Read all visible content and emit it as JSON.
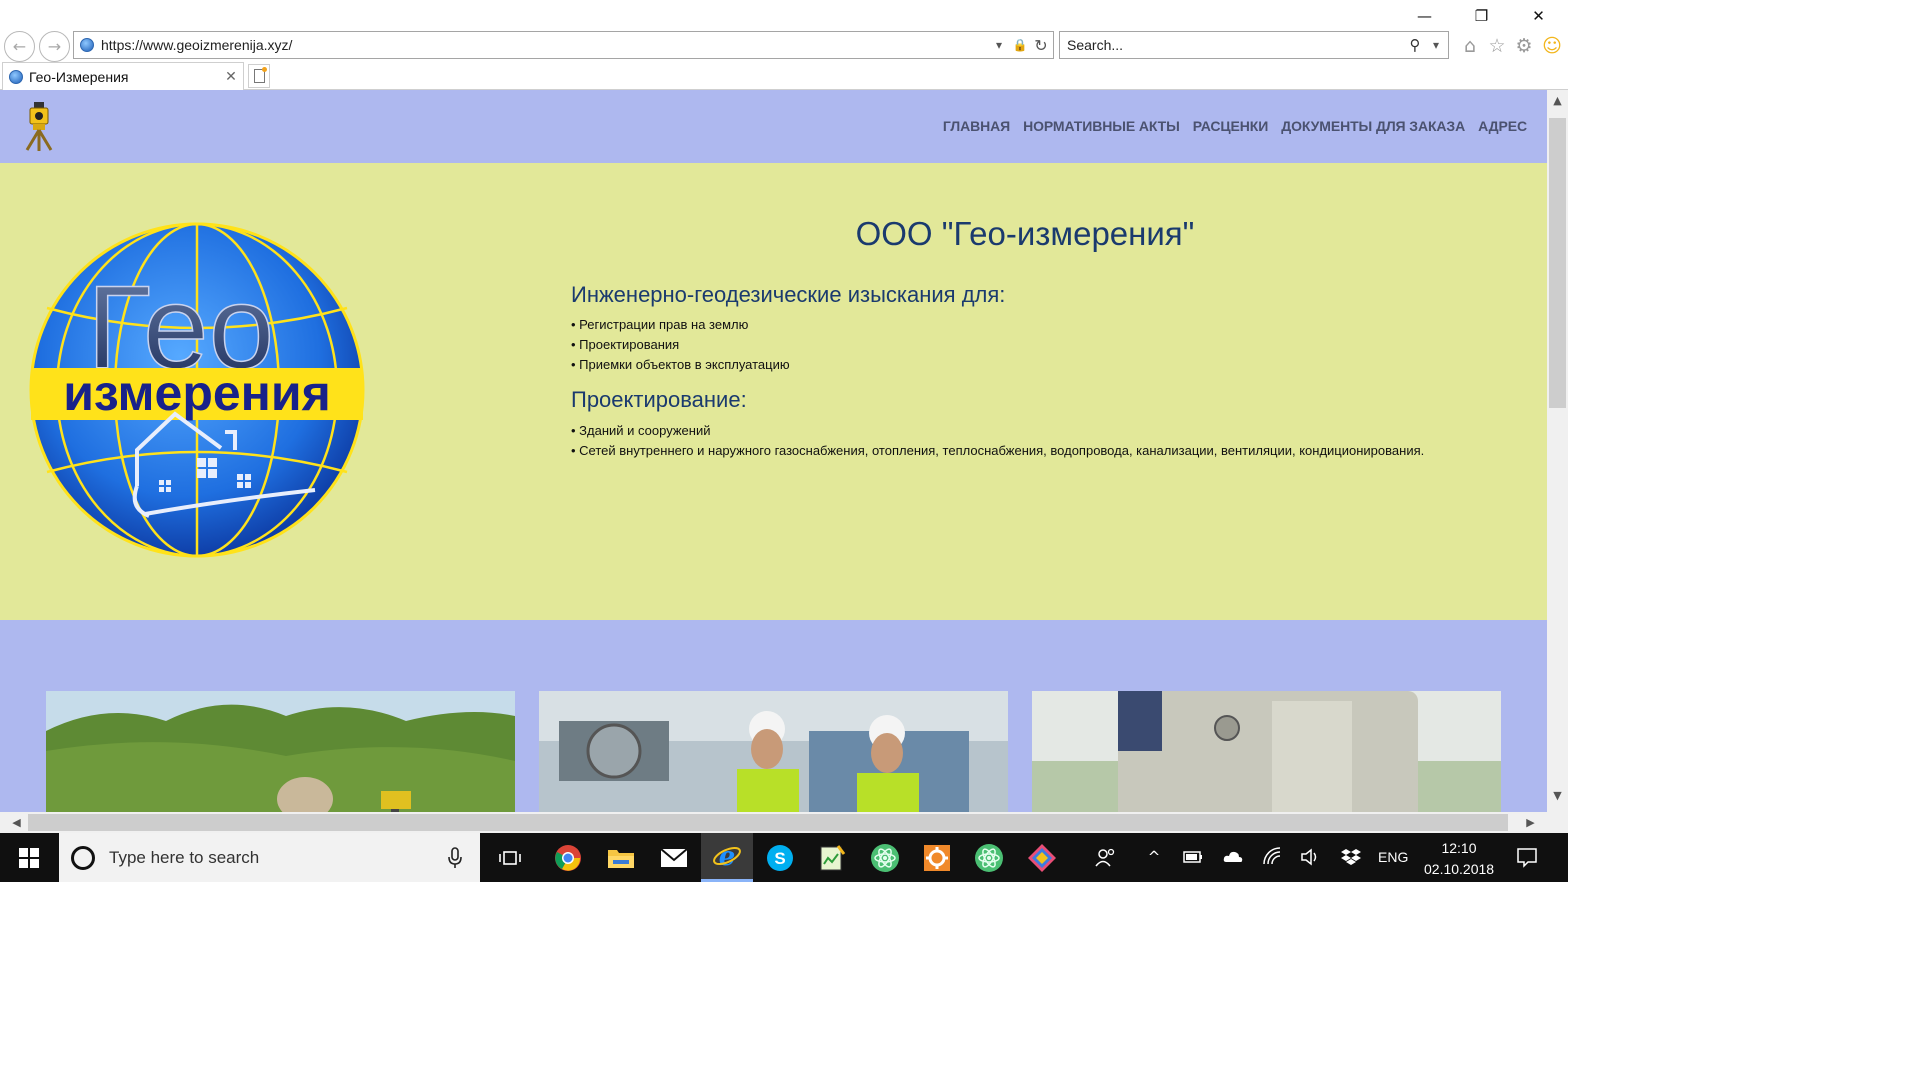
{
  "browser": {
    "url": "https://www.geoizmerenija.xyz/",
    "search_placeholder": "Search...",
    "tab_title": "Гео-Измерения",
    "close_glyph": "✕",
    "minimize_glyph": "—",
    "restore_glyph": "❐",
    "back_glyph": "←",
    "forward_glyph": "→",
    "dropdown_glyph": "▾",
    "lock_glyph": "🔒",
    "refresh_glyph": "↻",
    "search_glyph": "⚲",
    "home_glyph": "⌂",
    "favorites_glyph": "☆",
    "settings_glyph": "⚙",
    "feedback_glyph": "☺",
    "icons": [
      "back-icon",
      "forward-icon",
      "lock-icon",
      "refresh-icon",
      "search-icon",
      "home-icon",
      "star-icon",
      "gear-icon",
      "smiley-icon"
    ]
  },
  "site": {
    "nav": [
      {
        "label": "ГЛАВНАЯ"
      },
      {
        "label": "НОРМАТИВНЫЕ АКТЫ"
      },
      {
        "label": "РАСЦЕНКИ"
      },
      {
        "label": "ДОКУМЕНТЫ ДЛЯ ЗАКАЗА"
      },
      {
        "label": "АДРЕС"
      }
    ],
    "logo_text_top": "Гео",
    "logo_text_bottom": "измерения",
    "company": "ООО \"Гео-измерения\"",
    "section1": {
      "heading": "Инженерно-геодезические изыскания для:",
      "items": [
        "• Регистрации прав на землю",
        "• Проектирования",
        "• Приемки объектов в эксплуатацию"
      ]
    },
    "section2": {
      "heading": "Проектирование:",
      "items": [
        "• Зданий и сооружений",
        "• Сетей внутреннего и наружного газоснабжения, отопления, теплоснабжения, водопровода, канализации, вентиляции, кондиционирования."
      ]
    }
  },
  "scrollbars": {
    "up": "▲",
    "down": "▼",
    "left": "◀",
    "right": "▶"
  },
  "taskbar": {
    "search_placeholder": "Type here to search",
    "language": "ENG",
    "time": "12:10",
    "date": "02.10.2018",
    "tray_chevron": "^",
    "apps": [
      "task-view",
      "chrome",
      "file-explorer",
      "mail",
      "internet-explorer",
      "skype",
      "notepad-app",
      "atom",
      "settings-app",
      "atom",
      "git-app"
    ]
  },
  "colors": {
    "page_bg": "#aeb8ef",
    "hero_bg": "#e2e899",
    "heading_blue": "#1a3a6e",
    "nav_text": "#4b5270"
  }
}
